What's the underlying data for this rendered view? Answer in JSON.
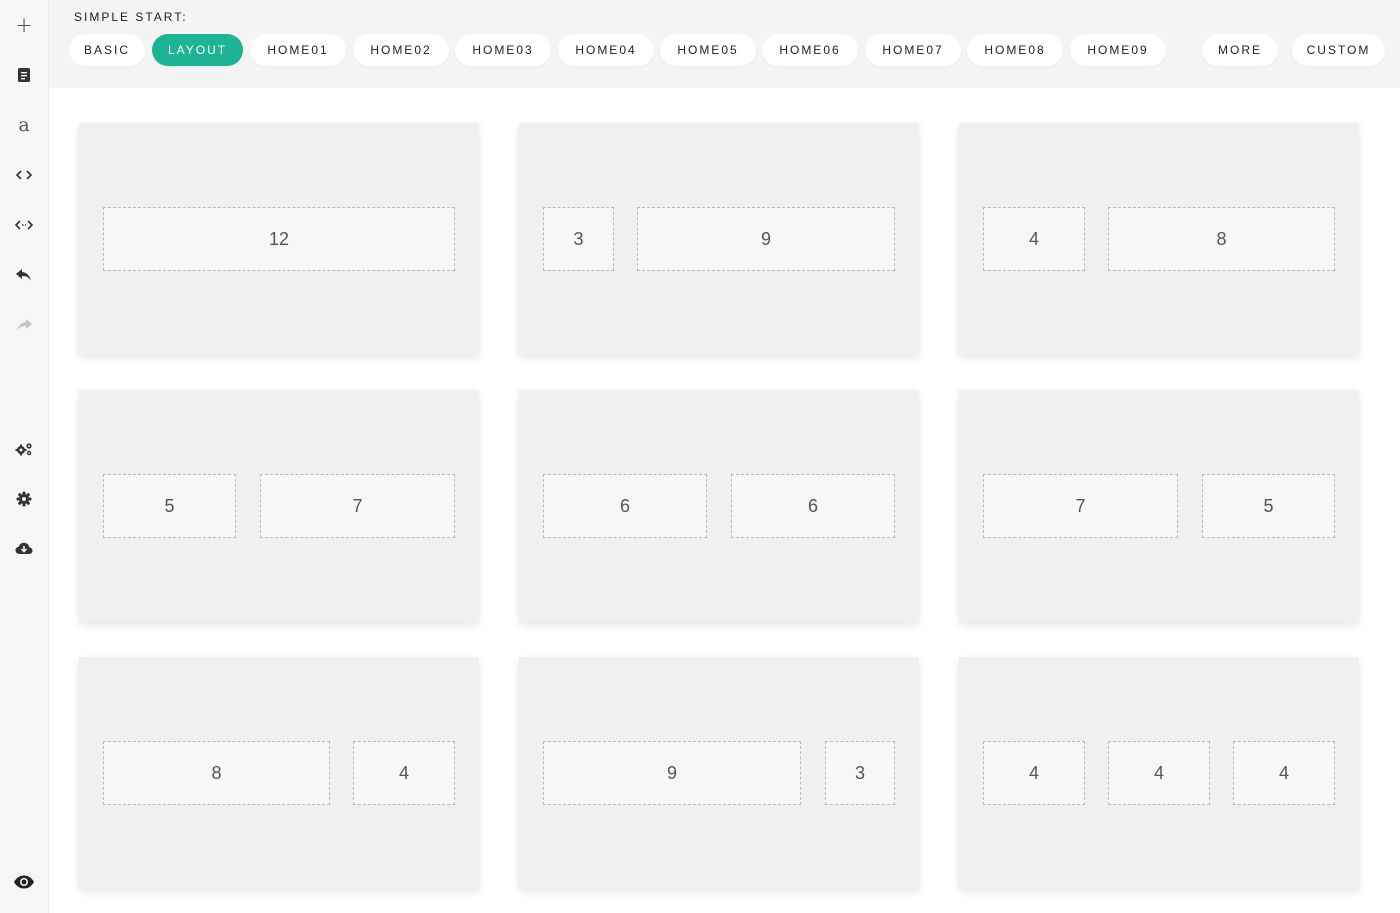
{
  "toolbar": {
    "items": [
      {
        "name": "add",
        "icon": "plus-icon",
        "glyph": "+"
      },
      {
        "name": "pages",
        "icon": "document-icon"
      },
      {
        "name": "text",
        "icon": "font-letter-icon",
        "glyph": "a"
      },
      {
        "name": "code",
        "icon": "code-brackets-icon"
      },
      {
        "name": "resize",
        "icon": "horizontal-arrows-icon"
      },
      {
        "name": "undo",
        "icon": "undo-icon"
      },
      {
        "name": "redo",
        "icon": "redo-icon",
        "disabled": true
      },
      {
        "name": "settings-advanced",
        "icon": "gears-icon"
      },
      {
        "name": "settings",
        "icon": "gear-icon"
      },
      {
        "name": "download",
        "icon": "cloud-download-icon"
      },
      {
        "name": "preview",
        "icon": "eye-icon"
      }
    ]
  },
  "header": {
    "label": "SIMPLE START:",
    "tabs": [
      {
        "label": "BASIC",
        "active": false
      },
      {
        "label": "LAYOUT",
        "active": true
      },
      {
        "label": "HOME01",
        "active": false
      },
      {
        "label": "HOME02",
        "active": false
      },
      {
        "label": "HOME03",
        "active": false
      },
      {
        "label": "HOME04",
        "active": false
      },
      {
        "label": "HOME05",
        "active": false
      },
      {
        "label": "HOME06",
        "active": false
      },
      {
        "label": "HOME07",
        "active": false
      },
      {
        "label": "HOME08",
        "active": false
      },
      {
        "label": "HOME09",
        "active": false
      },
      {
        "label": "MORE",
        "active": false
      },
      {
        "label": "CUSTOM",
        "active": false
      }
    ]
  },
  "layouts": [
    {
      "cols": [
        "12"
      ]
    },
    {
      "cols": [
        "3",
        "9"
      ]
    },
    {
      "cols": [
        "4",
        "8"
      ]
    },
    {
      "cols": [
        "5",
        "7"
      ]
    },
    {
      "cols": [
        "6",
        "6"
      ]
    },
    {
      "cols": [
        "7",
        "5"
      ]
    },
    {
      "cols": [
        "8",
        "4"
      ]
    },
    {
      "cols": [
        "9",
        "3"
      ]
    },
    {
      "cols": [
        "4",
        "4",
        "4"
      ]
    }
  ],
  "colors": {
    "accent": "#1db394",
    "card_bg": "#eff0f2",
    "col_bg": "#f7f7f7",
    "header_bg": "#f4f4f4"
  }
}
